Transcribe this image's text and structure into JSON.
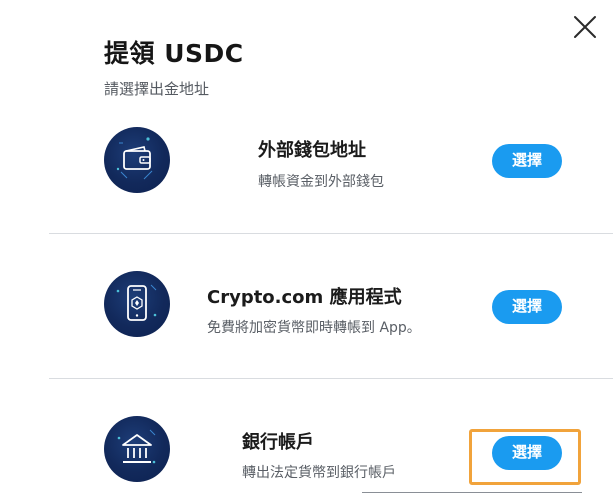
{
  "header": {
    "title": "提領 USDC",
    "subtitle": "請選擇出金地址"
  },
  "options": [
    {
      "title": "外部錢包地址",
      "description": "轉帳資金到外部錢包",
      "button_label": "選擇",
      "icon": "wallet-icon"
    },
    {
      "title": "Crypto.com 應用程式",
      "description": "免費將加密貨幣即時轉帳到 App。",
      "button_label": "選擇",
      "icon": "phone-app-icon"
    },
    {
      "title": "銀行帳戶",
      "description": "轉出法定貨幣到銀行帳戶",
      "button_label": "選擇",
      "icon": "bank-icon"
    }
  ],
  "colors": {
    "accent": "#1a9bf0",
    "icon_background": "#12295b",
    "highlight": "#f1a33b",
    "divider": "#d9dce0"
  }
}
